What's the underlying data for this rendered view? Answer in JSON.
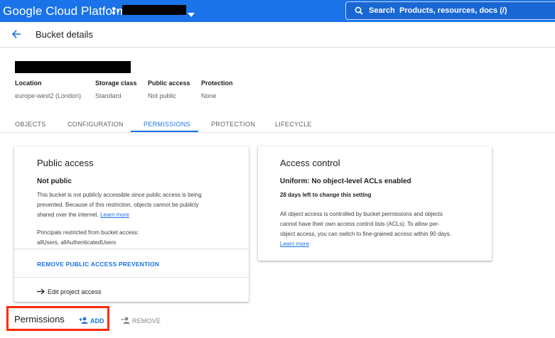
{
  "header": {
    "brand": "Google Cloud Platform",
    "project_name": "redacted-project",
    "search_label": "Search",
    "search_placeholder": "Products, resources, docs (/)"
  },
  "page": {
    "title": "Bucket details",
    "bucket_name": "redacted-bucket-name"
  },
  "bucket_meta": [
    {
      "label": "Location",
      "value": "europe-west2 (London)"
    },
    {
      "label": "Storage class",
      "value": "Standard"
    },
    {
      "label": "Public access",
      "value": "Not public"
    },
    {
      "label": "Protection",
      "value": "None"
    }
  ],
  "tabs": [
    {
      "label": "OBJECTS"
    },
    {
      "label": "CONFIGURATION"
    },
    {
      "label": "PERMISSIONS",
      "active": true
    },
    {
      "label": "PROTECTION"
    },
    {
      "label": "LIFECYCLE"
    }
  ],
  "public_access_card": {
    "title": "Public access",
    "status": "Not public",
    "description_line1": "This bucket is not publicly accessible since public access is being",
    "description_line2": "prevented. Because of this restriction, objects cannot be publicly",
    "description_line3": "shared over the internet.",
    "learn_more": "Learn more",
    "principals_label": "Principals restricted from bucket access:",
    "principals_value": "allUsers, allAuthenticatedUsers",
    "remove_prevention": "REMOVE PUBLIC ACCESS PREVENTION",
    "edit_project_access": "Edit project access"
  },
  "access_control_card": {
    "title": "Access control",
    "status": "Uniform: No object-level ACLs enabled",
    "days_left": "28 days left to change this setting",
    "description_line1": "All object access is controlled by bucket permissions and objects",
    "description_line2": "cannot have their own access control lists (ACLs). To allow per-",
    "description_line3": "object access, you can switch to fine-grained access within 90 days.",
    "learn_more": "Learn more"
  },
  "permissions": {
    "title": "Permissions",
    "add_label": "ADD",
    "remove_label": "REMOVE"
  },
  "colors": {
    "primary": "#1a73e8",
    "highlight": "#ff2a00"
  }
}
